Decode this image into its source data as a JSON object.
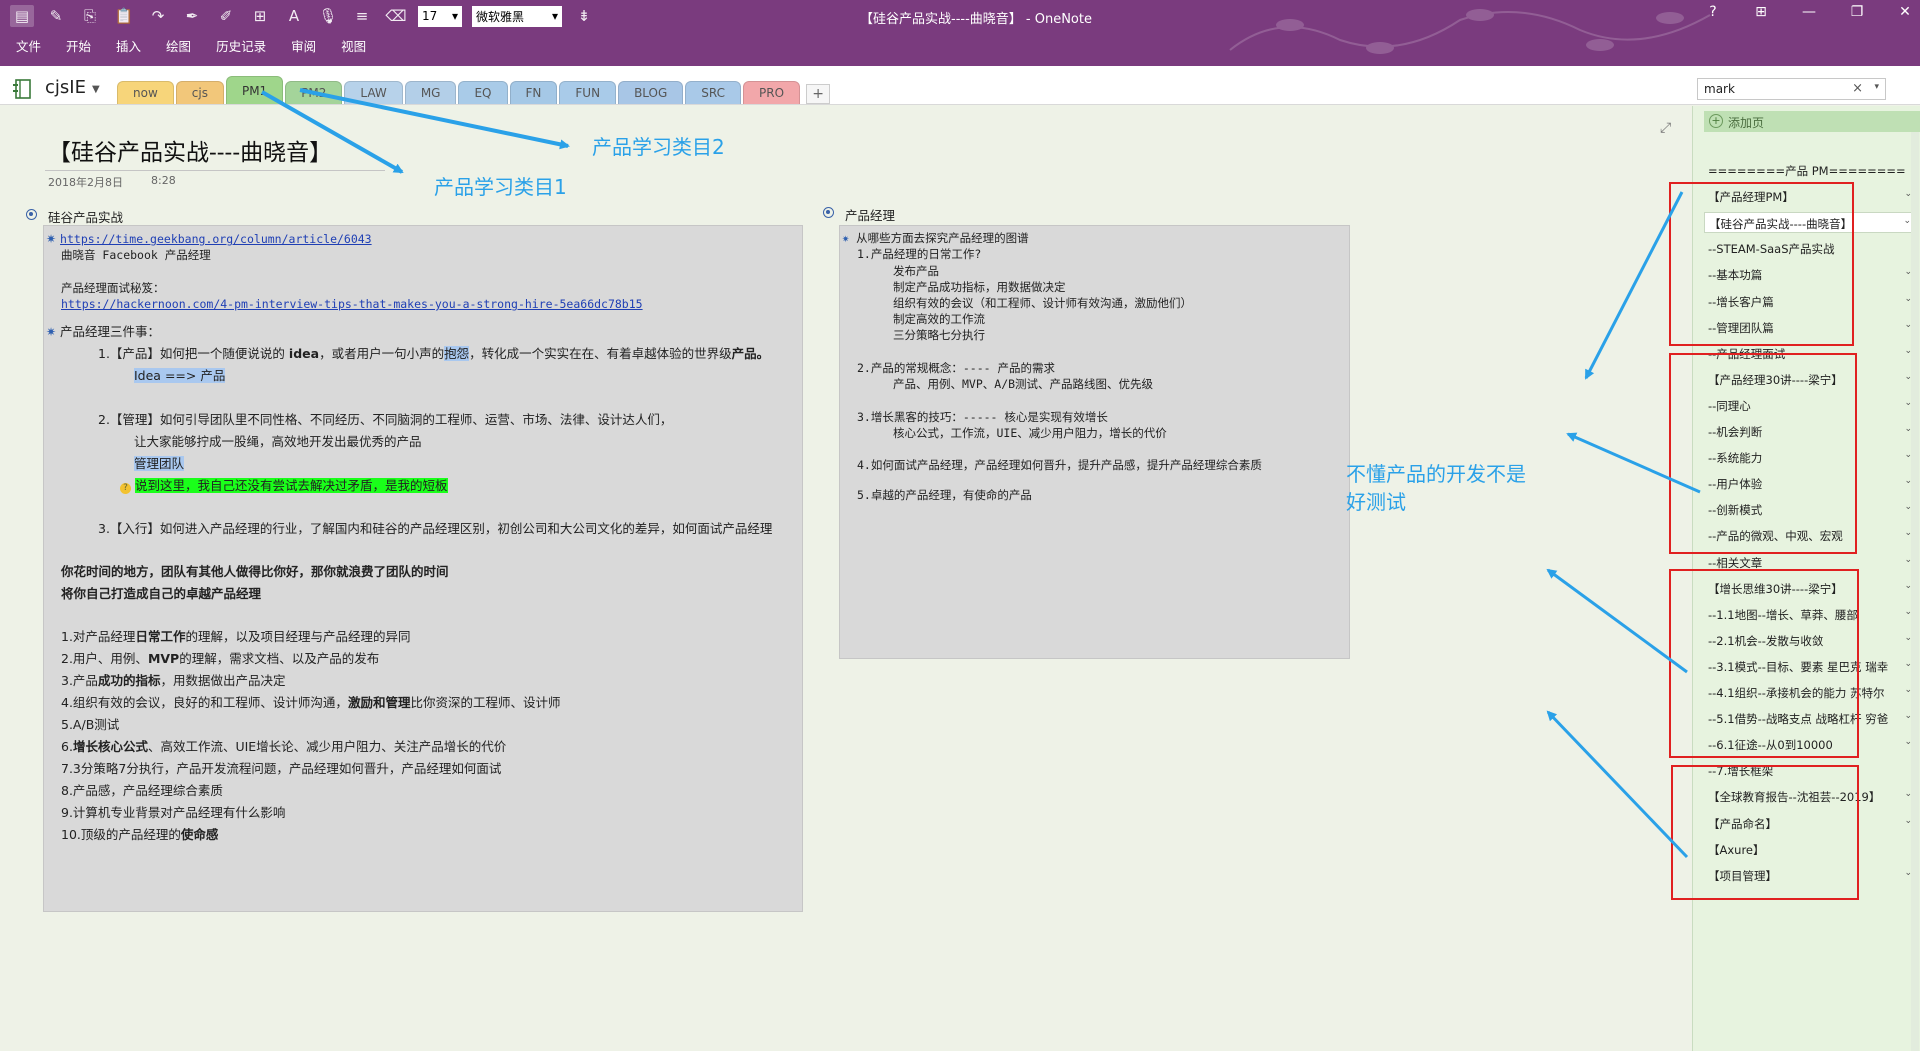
{
  "window": {
    "title": "【硅谷产品实战----曲晓音】 - OneNote",
    "controls": [
      "?",
      "⊞",
      "—",
      "❐",
      "✕"
    ]
  },
  "ribbon": {
    "font_size": "17",
    "font_name": "微软雅黑",
    "menu": [
      "文件",
      "开始",
      "插入",
      "绘图",
      "历史记录",
      "审阅",
      "视图"
    ]
  },
  "notebook": {
    "name": "cjsIE"
  },
  "tabs": [
    {
      "label": "now",
      "color": "#f7d57a"
    },
    {
      "label": "cjs",
      "color": "#f2c77a"
    },
    {
      "label": "PM1",
      "color": "#9fd68b",
      "active": true
    },
    {
      "label": "PM2",
      "color": "#a4d49a"
    },
    {
      "label": "LAW",
      "color": "#b7d2ea"
    },
    {
      "label": "MG",
      "color": "#b3cfe8"
    },
    {
      "label": "EQ",
      "color": "#a9cbe8"
    },
    {
      "label": "FN",
      "color": "#a5c8e6"
    },
    {
      "label": "FUN",
      "color": "#a9cbe9"
    },
    {
      "label": "BLOG",
      "color": "#a8c6e6"
    },
    {
      "label": "SRC",
      "color": "#a9c9e8"
    },
    {
      "label": "PRO",
      "color": "#f2a7aa"
    }
  ],
  "tab_add": "+",
  "search": {
    "value": "mark",
    "clear": "×",
    "dropdown": "▾"
  },
  "page": {
    "title": "【硅谷产品实战----曲晓音】",
    "date": "2018年2月8日",
    "time": "8:28"
  },
  "container1": {
    "heading": "硅谷产品实战",
    "lines": {
      "url1": "https://time.geekbang.org/column/article/6043",
      "l2": "曲晓音 Facebook 产品经理",
      "l3": "产品经理面试秘笈：",
      "url2": "https://hackernoon.com/4-pm-interview-tips-that-makes-you-a-strong-hire-5ea66dc78b15",
      "l5": "产品经理三件事：",
      "p1_a": "1.【产品】如何把一个随便说说的 ",
      "p1_idea": "idea",
      "p1_b": "，或者用户一句小声的",
      "p1_hl": "抱怨",
      "p1_c": "，转化成一个实实在在、有着卓越体验的世界级",
      "p1_d": "产品。",
      "p1_sub": "Idea ==> 产品",
      "p2": "2.【管理】如何引导团队里不同性格、不同经历、不同脑洞的工程师、运营、市场、法律、设计达人们，",
      "p2_b": "让大家能够拧成一股绳，高效地开发出最优秀的产品",
      "p2_sub": "管理团队",
      "p2_note": "说到这里，我自己还没有尝试去解决过矛盾，是我的短板",
      "p3": "3.【入行】如何进入产品经理的行业，了解国内和硅谷的产品经理区别，初创公司和大公司文化的差异，如何面试产品经理",
      "bold1": "你花时间的地方，团队有其他人做得比你好，那你就浪费了团队的时间",
      "bold2": "将你自己打造成自己的卓越产品经理",
      "t1_a": "1.对产品经理",
      "t1_b": "日常工作",
      "t1_c": "的理解，以及项目经理与产品经理的异同",
      "t2_a": "2.用户、用例、",
      "t2_b": "MVP",
      "t2_c": "的理解，需求文档、以及产品的发布",
      "t3_a": "3.产品",
      "t3_b": "成功的指标",
      "t3_c": "，用数据做出产品决定",
      "t4_a": "4.组织有效的会议，良好的和工程师、设计师沟通，",
      "t4_b": "激励和管理",
      "t4_c": "比你资深的工程师、设计师",
      "t5": "5.A/B测试",
      "t6_a": "6.",
      "t6_b": "增长核心公式",
      "t6_c": "、高效工作流、UIE增长论、减少用户阻力、关注产品增长的代价",
      "t7": "7.3分策略7分执行，产品开发流程问题，产品经理如何晋升，产品经理如何面试",
      "t8": "8.产品感，产品经理综合素质",
      "t9": "9.计算机专业背景对产品经理有什么影响",
      "t10_a": "10.顶级的产品经理的",
      "t10_b": "使命感"
    }
  },
  "container2": {
    "heading": "产品经理",
    "lines": [
      "从哪些方面去探究产品经理的图谱",
      "1.产品经理的日常工作?",
      "发布产品",
      "制定产品成功指标，用数据做决定",
      "组织有效的会议（和工程师、设计师有效沟通，激励他们）",
      "制定高效的工作流",
      "三分策略七分执行",
      "2.产品的常规概念：---- 产品的需求",
      "产品、用例、MVP、A/B测试、产品路线图、优先级",
      "3.增长黑客的技巧：----- 核心是实现有效增长",
      "核心公式，工作流，UIE、减少用户阻力，增长的代价",
      "4.如何面试产品经理，产品经理如何晋升，提升产品感，提升产品经理综合素质",
      "5.卓越的产品经理，有使命的产品"
    ]
  },
  "pages_panel": {
    "add_page": "添加页",
    "pages": [
      {
        "label": "========产品 PM========",
        "chev": false
      },
      {
        "label": "【产品经理PM】",
        "chev": true
      },
      {
        "label": "【硅谷产品实战----曲晓音】",
        "chev": true,
        "selected": true
      },
      {
        "label": "--STEAM-SaaS产品实战",
        "chev": false
      },
      {
        "label": "--基本功篇",
        "chev": true
      },
      {
        "label": "--增长客户篇",
        "chev": true
      },
      {
        "label": "--管理团队篇",
        "chev": true
      },
      {
        "label": "--产品经理面试",
        "chev": true
      },
      {
        "label": "【产品经理30讲----梁宁】",
        "chev": true
      },
      {
        "label": "--同理心",
        "chev": true
      },
      {
        "label": "--机会判断",
        "chev": true
      },
      {
        "label": "--系统能力",
        "chev": true
      },
      {
        "label": "--用户体验",
        "chev": true
      },
      {
        "label": "--创新模式",
        "chev": true
      },
      {
        "label": "--产品的微观、中观、宏观",
        "chev": true
      },
      {
        "label": "--相关文章",
        "chev": true
      },
      {
        "label": "【增长思维30讲----梁宁】",
        "chev": true
      },
      {
        "label": "--1.1地图--增长、草莽、腰部",
        "chev": true
      },
      {
        "label": "--2.1机会--发散与收敛",
        "chev": true
      },
      {
        "label": "--3.1模式--目标、要素 星巴克 瑞幸",
        "chev": true
      },
      {
        "label": "--4.1组织--承接机会的能力 苏特尔",
        "chev": true
      },
      {
        "label": "--5.1借势--战略支点 战略杠杆 穷爸",
        "chev": true
      },
      {
        "label": "--6.1征途--从0到10000",
        "chev": true
      },
      {
        "label": "--7.增长框架",
        "chev": false
      },
      {
        "label": "【全球教育报告--沈祖芸--2019】",
        "chev": true
      },
      {
        "label": "【产品命名】",
        "chev": true
      },
      {
        "label": "【Axure】",
        "chev": false
      },
      {
        "label": "【项目管理】",
        "chev": true
      }
    ]
  },
  "annotations": {
    "category1": "产品学习类目1",
    "category2": "产品学习类目2",
    "note_line1": "不懂产品的开发不是",
    "note_line2": "好测试"
  },
  "colors": {
    "ribbon": "#7a3b7e",
    "annotation": "#2aa1e8",
    "redbox": "#e02020",
    "panel": "#e7f3df"
  }
}
